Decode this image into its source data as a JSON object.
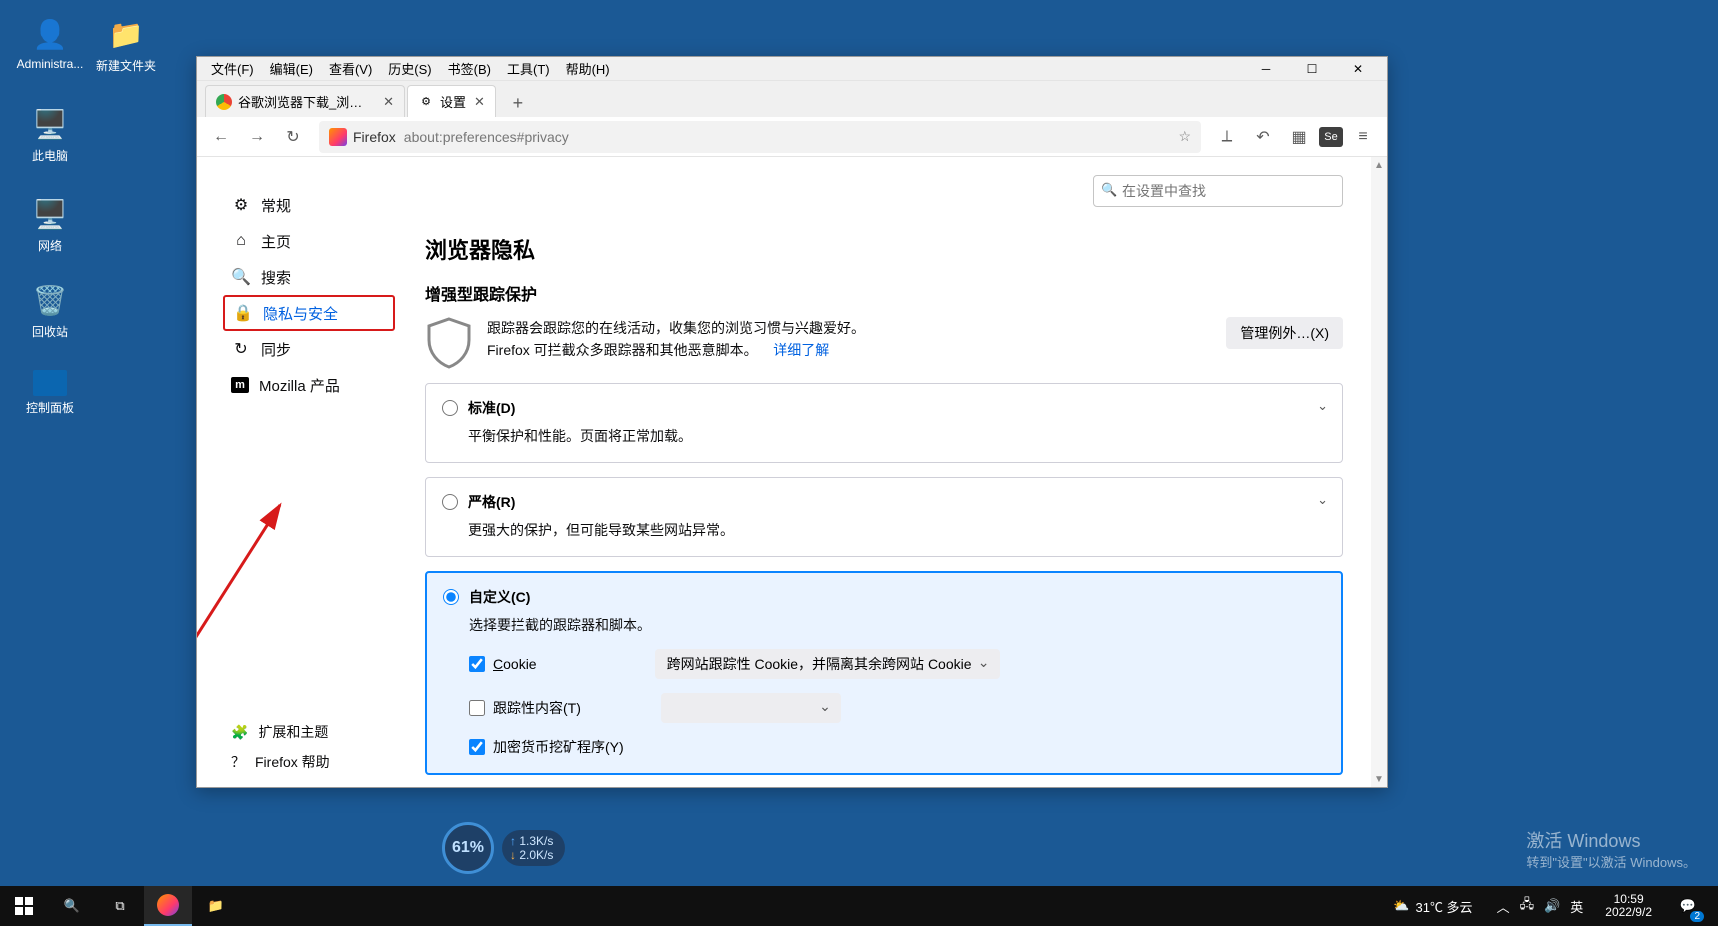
{
  "desktop": {
    "admin": "Administra...",
    "newfolder": "新建文件夹",
    "pc": "此电脑",
    "net": "网络",
    "recycle": "回收站",
    "cpl": "控制面板"
  },
  "menubar": [
    "文件(F)",
    "编辑(E)",
    "查看(V)",
    "历史(S)",
    "书签(B)",
    "工具(T)",
    "帮助(H)"
  ],
  "tabs": [
    {
      "title": "谷歌浏览器下载_浏览器官网入口",
      "active": false
    },
    {
      "title": "设置",
      "active": true
    }
  ],
  "url": {
    "site": "Firefox",
    "path": "about:preferences#privacy"
  },
  "toolbar_icons": {
    "back": "←",
    "forward": "→",
    "reload": "↻",
    "cut": "✂",
    "undo": "↶",
    "grid": "⠿",
    "se": "Se",
    "menu": "≡"
  },
  "sidebar": {
    "items": [
      {
        "icon": "⚙",
        "label": "常规"
      },
      {
        "icon": "⌂",
        "label": "主页"
      },
      {
        "icon": "🔍",
        "label": "搜索"
      },
      {
        "icon": "🔒",
        "label": "隐私与安全",
        "active": true
      },
      {
        "icon": "↻",
        "label": "同步"
      },
      {
        "icon": "m",
        "label": "Mozilla 产品"
      }
    ],
    "footer": [
      {
        "icon": "🧩",
        "label": "扩展和主题"
      },
      {
        "icon": "？",
        "label": "Firefox 帮助"
      }
    ]
  },
  "search_placeholder": "在设置中查找",
  "main": {
    "h1": "浏览器隐私",
    "h2": "增强型跟踪保护",
    "intro1": "跟踪器会跟踪您的在线活动，收集您的浏览习惯与兴趣爱好。",
    "intro2_prefix": "Firefox 可拦截众多跟踪器和其他恶意脚本。",
    "intro2_link": "详细了解",
    "btn_exceptions": "管理例外…(X)",
    "standard": {
      "title": "标准(D)",
      "desc": "平衡保护和性能。页面将正常加载。"
    },
    "strict": {
      "title": "严格(R)",
      "desc": "更强大的保护，但可能导致某些网站异常。"
    },
    "custom": {
      "title": "自定义(C)",
      "desc": "选择要拦截的跟踪器和脚本。",
      "cookie_label": "Cookie",
      "cookie_option": "跨网站跟踪性 Cookie，并隔离其余跨网站 Cookie",
      "tracking_label": "跟踪性内容(T)",
      "miner_label": "加密货币挖矿程序(Y)"
    }
  },
  "net": {
    "percent": "61%",
    "up": "1.3K/s",
    "down": "2.0K/s"
  },
  "watermark": {
    "l1": "激活 Windows",
    "l2": "转到\"设置\"以激活 Windows。"
  },
  "taskbar": {
    "weather": "31℃ 多云",
    "ime": "英",
    "time": "10:59",
    "date": "2022/9/2",
    "notif_count": "2"
  }
}
